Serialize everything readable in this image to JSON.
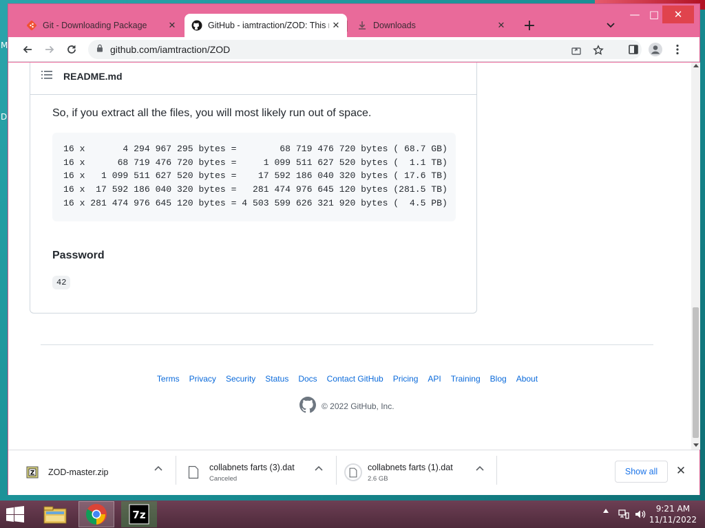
{
  "desktop": {
    "left_letters": [
      "M",
      "D"
    ]
  },
  "window": {
    "controls": {
      "minimize": "—",
      "maximize": "□",
      "close": "✕"
    },
    "tabs": [
      {
        "label": "Git - Downloading Package",
        "icon": "git-icon",
        "active": false
      },
      {
        "label": "GitHub - iamtraction/ZOD: This r",
        "icon": "github-icon",
        "active": true
      },
      {
        "label": "Downloads",
        "icon": "download-icon",
        "active": false
      }
    ],
    "new_tab": "+"
  },
  "toolbar": {
    "url": "github.com/iamtraction/ZOD"
  },
  "readme": {
    "filename": "README.md",
    "paragraph": "So, if you extract all the files, you will most likely run out of space.",
    "code_lines": [
      "16 x       4 294 967 295 bytes =        68 719 476 720 bytes ( 68.7 GB)",
      "16 x      68 719 476 720 bytes =     1 099 511 627 520 bytes (  1.1 TB)",
      "16 x   1 099 511 627 520 bytes =    17 592 186 040 320 bytes ( 17.6 TB)",
      "16 x  17 592 186 040 320 bytes =   281 474 976 645 120 bytes (281.5 TB)",
      "16 x 281 474 976 645 120 bytes = 4 503 599 626 321 920 bytes (  4.5 PB)"
    ],
    "password_heading": "Password",
    "password_value": "42"
  },
  "footer": {
    "links": [
      "Terms",
      "Privacy",
      "Security",
      "Status",
      "Docs",
      "Contact GitHub",
      "Pricing",
      "API",
      "Training",
      "Blog",
      "About"
    ],
    "copyright": "© 2022 GitHub, Inc."
  },
  "downloads": {
    "items": [
      {
        "name": "ZOD-master.zip",
        "status": ""
      },
      {
        "name": "collabnets farts (3).dat",
        "status": "Canceled"
      },
      {
        "name": "collabnets farts (1).dat",
        "status": "2.6 GB"
      }
    ],
    "show_all": "Show all",
    "close": "✕"
  },
  "taskbar": {
    "time": "9:21 AM",
    "date": "11/11/2022"
  },
  "colors": {
    "window_frame": "#e96a9a",
    "link": "#0969da",
    "accent": "#1a73e8"
  }
}
